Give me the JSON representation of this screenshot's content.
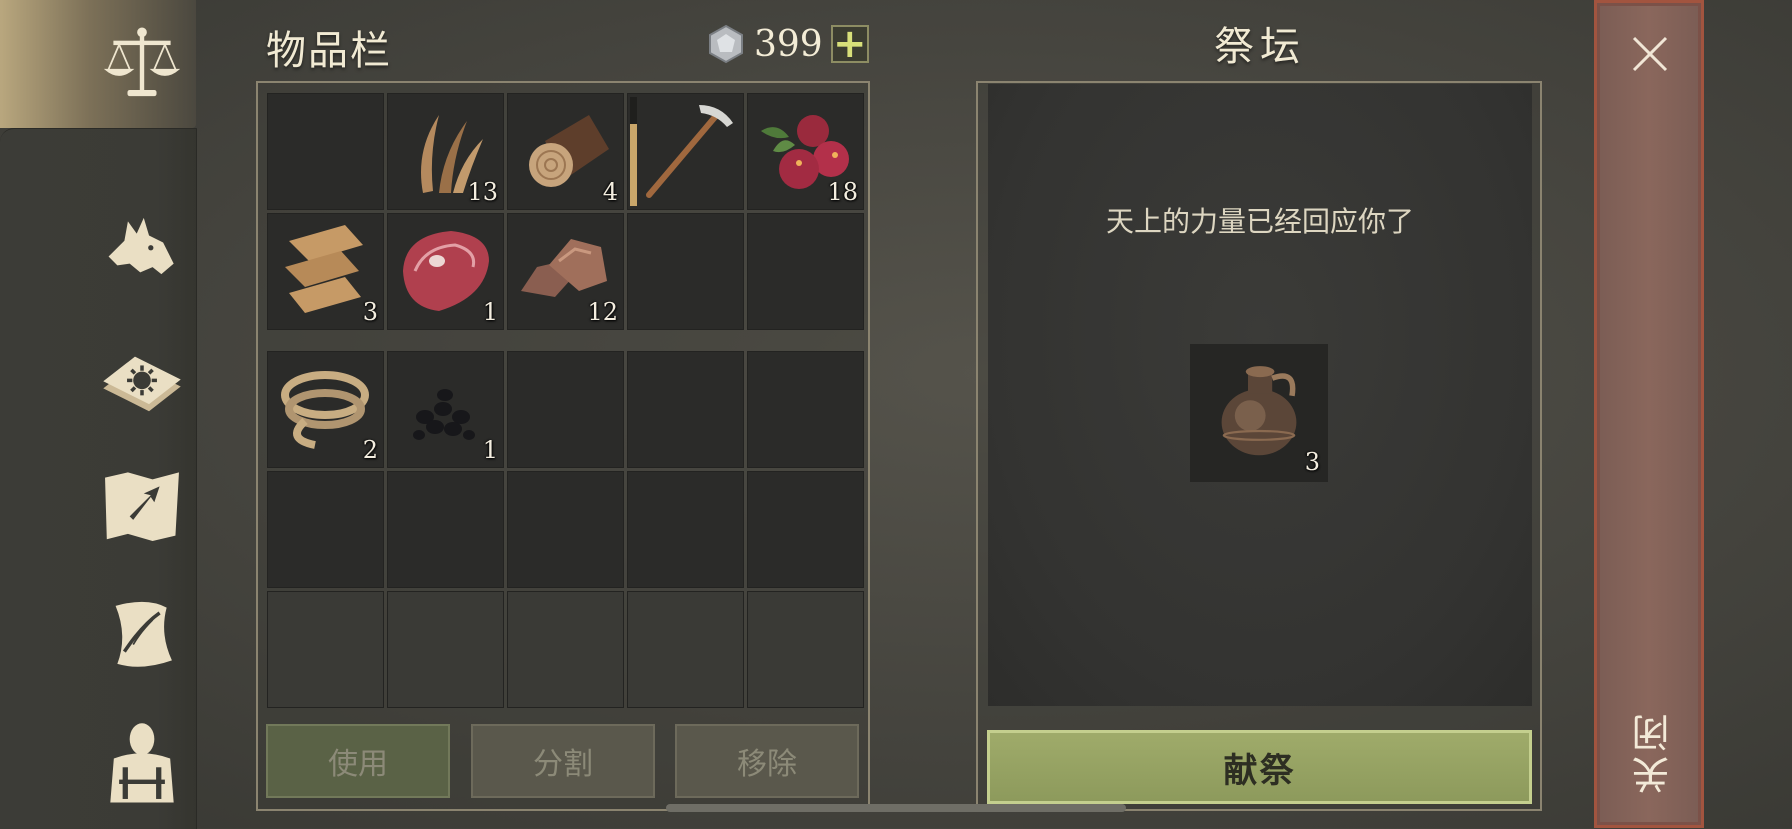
{
  "inventory": {
    "title": "物品栏",
    "currency_amount": "399",
    "add_currency": "+",
    "slots": [
      {
        "icon": "empty",
        "qty": ""
      },
      {
        "icon": "plant-fiber-icon",
        "qty": "13"
      },
      {
        "icon": "log-icon",
        "qty": "4"
      },
      {
        "icon": "pickaxe-icon",
        "qty": "",
        "durability": 0.75
      },
      {
        "icon": "berries-icon",
        "qty": "18"
      },
      {
        "icon": "leather-icon",
        "qty": "3"
      },
      {
        "icon": "raw-meat-icon",
        "qty": "1"
      },
      {
        "icon": "copper-ore-icon",
        "qty": "12"
      },
      {
        "icon": "empty",
        "qty": ""
      },
      {
        "icon": "empty",
        "qty": ""
      }
    ],
    "backpack_slots": [
      {
        "icon": "rope-icon",
        "qty": "2"
      },
      {
        "icon": "coal-icon",
        "qty": "1"
      }
    ],
    "buttons": {
      "use": "使用",
      "split": "分割",
      "remove": "移除"
    }
  },
  "altar": {
    "title": "祭坛",
    "message": "天上的力量已经回应你了",
    "slot": {
      "icon": "clay-jug-icon",
      "qty": "3"
    },
    "offer_button": "献祭"
  },
  "close_label": "关闭",
  "tabs": [
    "balance-scale-icon",
    "wolf-icon",
    "sun-book-icon",
    "map-arrow-icon",
    "scroll-quill-icon",
    "backpack-icon"
  ],
  "colors": {
    "offer_button": "#9fab6a",
    "close_strip": "#8a675c",
    "accent_border": "#8b8470"
  }
}
